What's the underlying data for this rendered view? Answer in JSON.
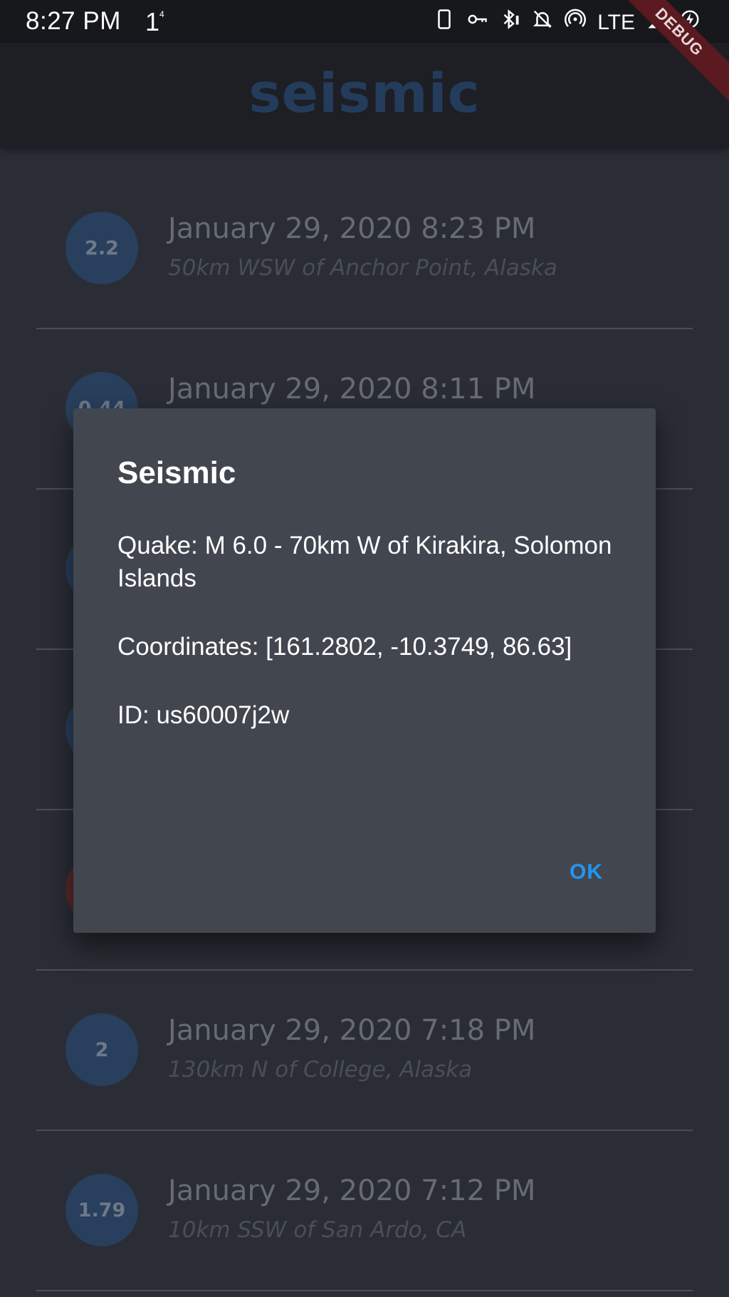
{
  "status_bar": {
    "time": "8:27 PM",
    "extra": "1",
    "extra_sup": "4",
    "network": "LTE",
    "icons": [
      "phone-icon",
      "key-icon",
      "bluetooth-icon",
      "notifications-off-icon",
      "hotspot-icon",
      "signal-icon",
      "battery-charging-icon"
    ]
  },
  "debug_banner": "DEBUG",
  "app_bar": {
    "title": "seismic"
  },
  "list": {
    "items": [
      {
        "magnitude": "2.2",
        "date": "January 29, 2020 8:23 PM",
        "place": "50km WSW of Anchor Point, Alaska",
        "color": "#283f5d"
      },
      {
        "magnitude": "0.44",
        "date": "January 29, 2020 8:11 PM",
        "place": "",
        "color": "#283f5d"
      },
      {
        "magnitude": "",
        "date": "",
        "place": "",
        "color": "#283f5d"
      },
      {
        "magnitude": "",
        "date": "",
        "place": "",
        "color": "#283f5d"
      },
      {
        "magnitude": "",
        "date": "",
        "place": "",
        "color": "#5a2829"
      },
      {
        "magnitude": "2",
        "date": "January 29, 2020 7:18 PM",
        "place": "130km N of College, Alaska",
        "color": "#283f5d"
      },
      {
        "magnitude": "1.79",
        "date": "January 29, 2020 7:12 PM",
        "place": "10km SSW of San Ardo, CA",
        "color": "#283f5d"
      }
    ]
  },
  "dialog": {
    "title": "Seismic",
    "quake": "Quake: M 6.0 - 70km W of Kirakira, Solomon Islands",
    "coordinates": "Coordinates: [161.2802, -10.3749, 86.63]",
    "id": "ID: us60007j2w",
    "ok_label": "OK"
  }
}
